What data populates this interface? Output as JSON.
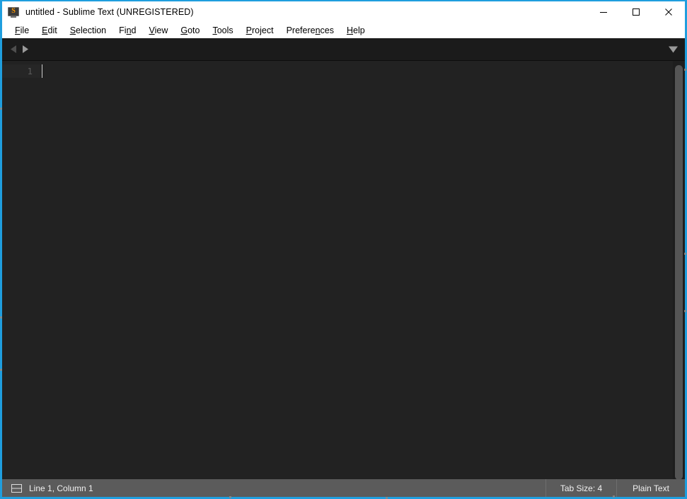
{
  "window": {
    "title": "untitled - Sublime Text (UNREGISTERED)",
    "app_icon": "sublime-text-icon",
    "border_color": "#1f9ede",
    "controls": {
      "minimize": "minimize-icon",
      "maximize": "maximize-icon",
      "close": "close-icon"
    }
  },
  "menu": {
    "items": [
      {
        "label": "File",
        "accel": "F"
      },
      {
        "label": "Edit",
        "accel": "E"
      },
      {
        "label": "Selection",
        "accel": "S"
      },
      {
        "label": "Find",
        "accel": "n"
      },
      {
        "label": "View",
        "accel": "V"
      },
      {
        "label": "Goto",
        "accel": "G"
      },
      {
        "label": "Tools",
        "accel": "T"
      },
      {
        "label": "Project",
        "accel": "P"
      },
      {
        "label": "Preferences",
        "accel": "n"
      },
      {
        "label": "Help",
        "accel": "H"
      }
    ]
  },
  "tab_bar": {
    "prev_icon": "arrow-left-icon",
    "next_icon": "arrow-right-icon",
    "dropdown_icon": "chevron-down-icon",
    "tabs": []
  },
  "editor": {
    "line_numbers": [
      "1"
    ],
    "content": "",
    "background": "#222222",
    "gutter_highlight": "#262626",
    "scrollbar_thumb_color": "#555555"
  },
  "status_bar": {
    "panel_icon": "split-panel-icon",
    "position": "Line 1, Column 1",
    "tab_size": "Tab Size: 4",
    "syntax": "Plain Text",
    "background": "#5b5b5b"
  }
}
